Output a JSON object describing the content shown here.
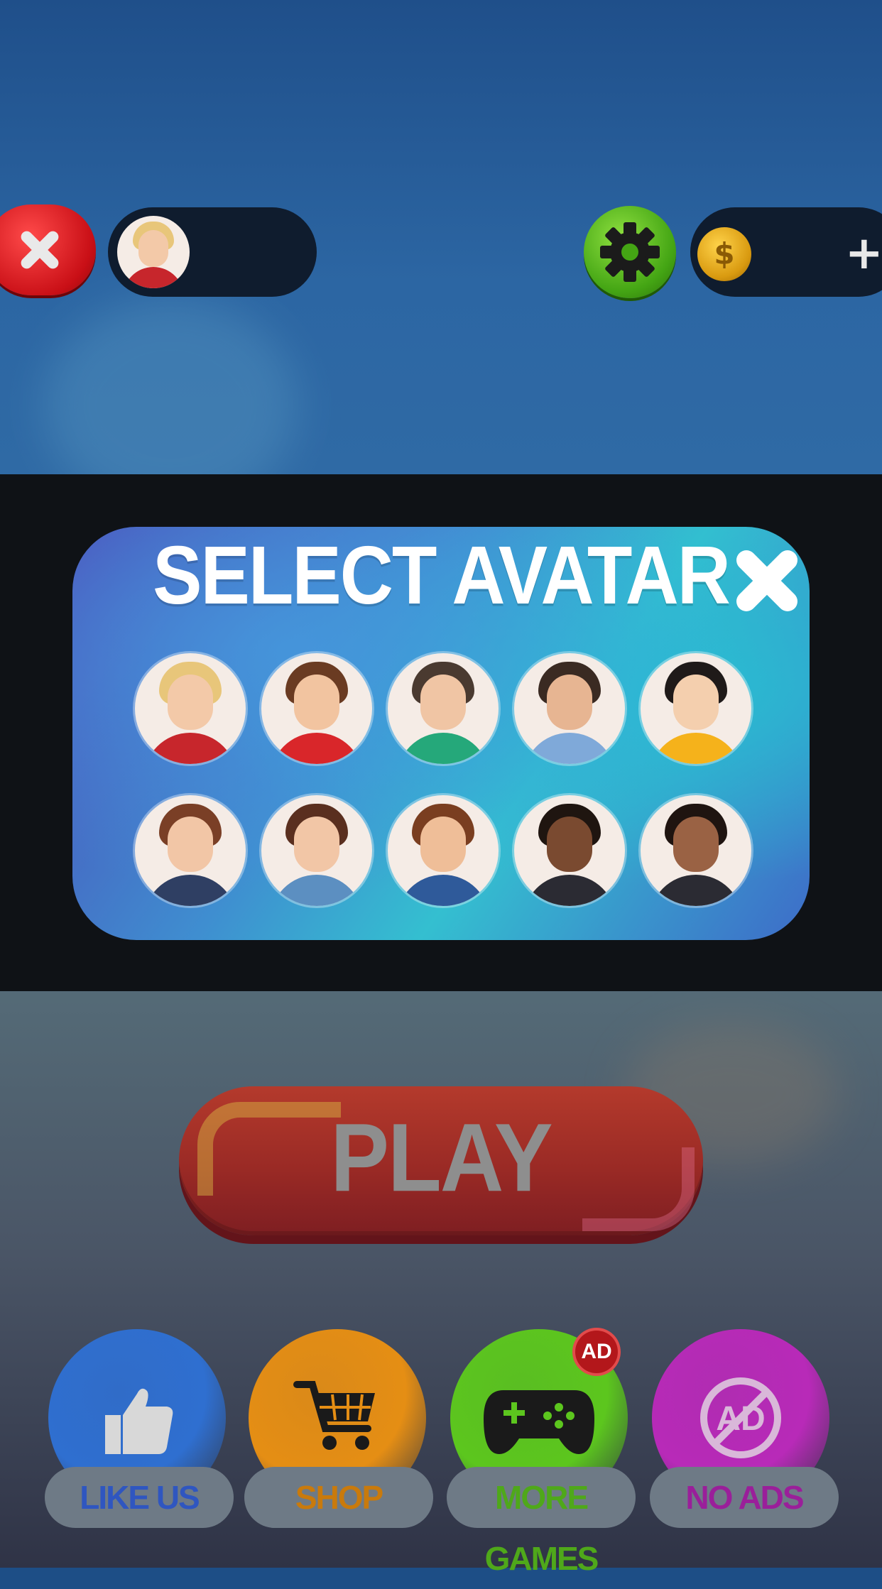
{
  "top_bar": {
    "exit_icon": "close-icon",
    "settings_icon": "gear-icon",
    "coin_icon": "coin-icon",
    "coin_symbol": "$",
    "add_coins_symbol": "+"
  },
  "modal": {
    "title": "SELECT AVATAR",
    "close_icon": "close-icon",
    "avatars": [
      {
        "id": "blonde-glasses-woman",
        "hair": "#e8c67a",
        "skin": "#f3c9a8",
        "shirt": "#c7262c"
      },
      {
        "id": "brown-hair-boy-hoodie",
        "hair": "#6a3b22",
        "skin": "#f2c4a0",
        "shirt": "#d9262a"
      },
      {
        "id": "short-hair-woman-green",
        "hair": "#4a3a30",
        "skin": "#f0c5a4",
        "shirt": "#25a87a"
      },
      {
        "id": "bearded-man-blue",
        "hair": "#3a2a22",
        "skin": "#e7b592",
        "shirt": "#7fa9d9"
      },
      {
        "id": "black-hair-man-yellow",
        "hair": "#1f1a19",
        "skin": "#f4cfae",
        "shirt": "#f5b21b"
      },
      {
        "id": "long-hair-woman-striped",
        "hair": "#7a3f26",
        "skin": "#f2c6a6",
        "shirt": "#2f3f63"
      },
      {
        "id": "long-hair-woman-denim",
        "hair": "#5a2f1f",
        "skin": "#f2c6a6",
        "shirt": "#5c8fc1"
      },
      {
        "id": "mustache-man",
        "hair": "#7a3e20",
        "skin": "#efbe98",
        "shirt": "#2f5a9a"
      },
      {
        "id": "businessman-glasses",
        "hair": "#1f1510",
        "skin": "#7a4a30",
        "shirt": "#2b2b33"
      },
      {
        "id": "short-hair-woman-dark",
        "hair": "#1f1410",
        "skin": "#9a6244",
        "shirt": "#2b2b33"
      }
    ]
  },
  "play_button": {
    "label": "PLAY"
  },
  "menu": [
    {
      "label": "LIKE US",
      "icon": "thumbs-up-icon",
      "color": "#2f6fd0",
      "text_color": "#2f56c0"
    },
    {
      "label": "SHOP",
      "icon": "cart-icon",
      "color": "#e58e14",
      "text_color": "#c97a0c"
    },
    {
      "label": "MORE GAMES",
      "icon": "gamepad-icon",
      "color": "#5cc61e",
      "text_color": "#4fa81a",
      "badge": "AD"
    },
    {
      "label": "NO ADS",
      "icon": "no-ads-icon",
      "color": "#b82ab8",
      "text_color": "#9a1f9a",
      "icon_text": "AD"
    }
  ]
}
